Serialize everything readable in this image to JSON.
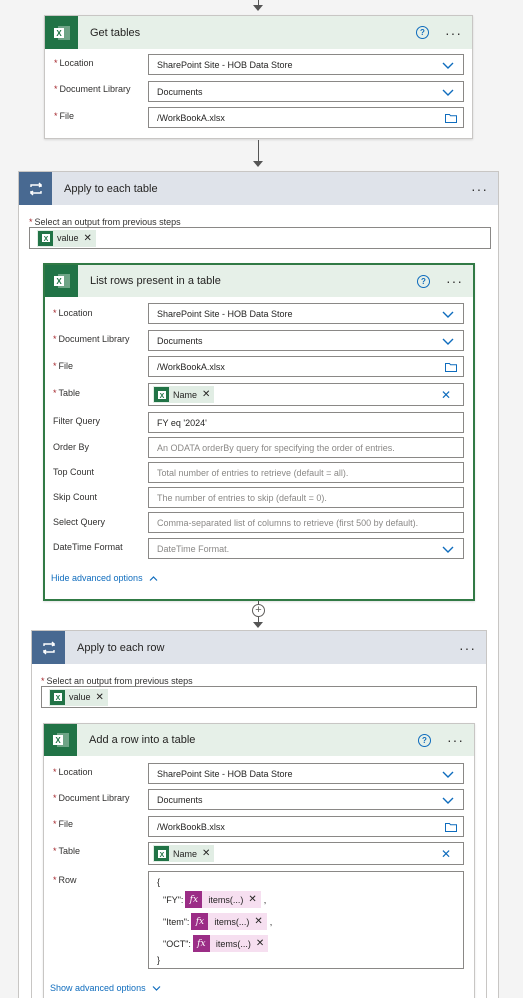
{
  "get_tables": {
    "title": "Get tables",
    "fields": {
      "location": {
        "label": "Location",
        "value": "SharePoint Site - HOB Data Store"
      },
      "library": {
        "label": "Document Library",
        "value": "Documents"
      },
      "file": {
        "label": "File",
        "value": "/WorkBookA.xlsx"
      }
    }
  },
  "apply_table": {
    "title": "Apply to each table",
    "select_label": "Select an output from previous steps",
    "token": "value"
  },
  "list_rows": {
    "title": "List rows present in a table",
    "fields": {
      "location": {
        "label": "Location",
        "value": "SharePoint Site - HOB Data Store"
      },
      "library": {
        "label": "Document Library",
        "value": "Documents"
      },
      "file": {
        "label": "File",
        "value": "/WorkBookA.xlsx"
      },
      "table": {
        "label": "Table",
        "token": "Name"
      },
      "filter": {
        "label": "Filter Query",
        "value": "FY eq '2024'"
      },
      "order": {
        "label": "Order By",
        "placeholder": "An ODATA orderBy query for specifying the order of entries."
      },
      "top": {
        "label": "Top Count",
        "placeholder": "Total number of entries to retrieve (default = all)."
      },
      "skip": {
        "label": "Skip Count",
        "placeholder": "The number of entries to skip (default = 0)."
      },
      "select": {
        "label": "Select Query",
        "placeholder": "Comma-separated list of columns to retrieve (first 500 by default)."
      },
      "datetime": {
        "label": "DateTime Format",
        "placeholder": "DateTime Format."
      }
    },
    "advanced_link": "Hide advanced options"
  },
  "apply_row": {
    "title": "Apply to each row",
    "select_label": "Select an output from previous steps",
    "token": "value"
  },
  "add_row": {
    "title": "Add a row into a table",
    "fields": {
      "location": {
        "label": "Location",
        "value": "SharePoint Site - HOB Data Store"
      },
      "library": {
        "label": "Document Library",
        "value": "Documents"
      },
      "file": {
        "label": "File",
        "value": "/WorkBookB.xlsx"
      },
      "table": {
        "label": "Table",
        "token": "Name"
      },
      "row": {
        "label": "Row"
      }
    },
    "row_json": {
      "open": "{",
      "close": "}",
      "entries": [
        {
          "key": "\"FY\":",
          "expr": "items(...)",
          "sep": ","
        },
        {
          "key": "\"Item\":",
          "expr": "items(...)",
          "sep": ","
        },
        {
          "key": "\"OCT\":",
          "expr": "items(...)",
          "sep": ""
        }
      ]
    },
    "advanced_link": "Show advanced options"
  },
  "icons": [
    "excel-icon",
    "loop-icon",
    "help-icon",
    "more-icon",
    "chevron-down-icon",
    "folder-icon",
    "close-icon",
    "plus-icon",
    "fx-icon",
    "chevron-up-icon"
  ],
  "colors": {
    "excel_green": "#217346",
    "loop_blue": "#486991",
    "link_blue": "#0f6cbd",
    "selected_border": "#317a45",
    "fx_purple": "#9b2d86"
  }
}
